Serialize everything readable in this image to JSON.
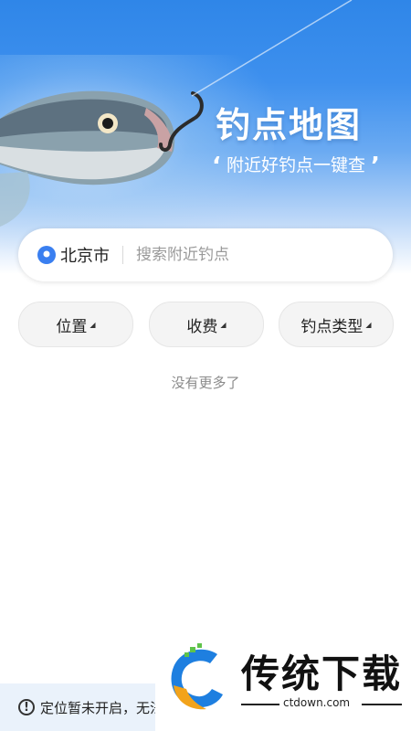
{
  "hero": {
    "title": "钓点地图",
    "subtitle": "附近好钓点一键查",
    "open_quote": "‘",
    "close_quote": "’"
  },
  "search": {
    "city": "北京市",
    "placeholder": "搜索附近钓点"
  },
  "filters": [
    {
      "label": "位置"
    },
    {
      "label": "收费"
    },
    {
      "label": "钓点类型"
    }
  ],
  "list": {
    "empty_text": "没有更多了"
  },
  "notice": {
    "text": "定位暂未开启，无法"
  },
  "watermark": {
    "brand": "传统下载",
    "url": "ctdown.com"
  },
  "colors": {
    "accent": "#2f86e8",
    "pin": "#3a7ff0"
  }
}
